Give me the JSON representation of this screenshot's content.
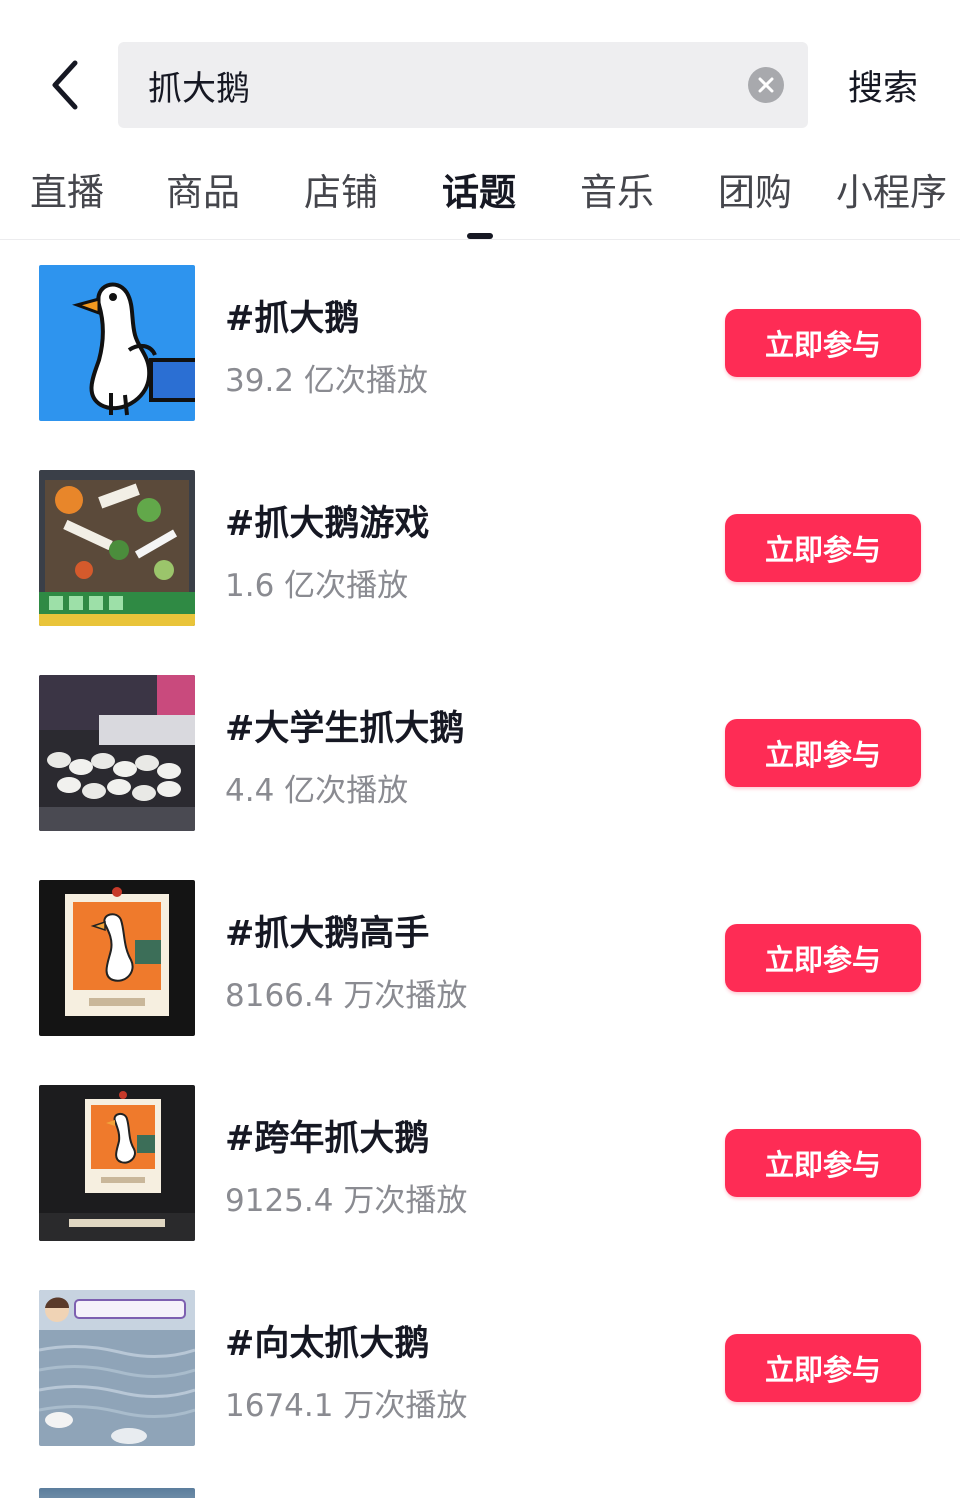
{
  "search": {
    "query": "抓大鹅",
    "button_label": "搜索"
  },
  "tabs": [
    {
      "label": "直播",
      "active": false
    },
    {
      "label": "商品",
      "active": false
    },
    {
      "label": "店铺",
      "active": false
    },
    {
      "label": "话题",
      "active": true
    },
    {
      "label": "音乐",
      "active": false
    },
    {
      "label": "团购",
      "active": false
    },
    {
      "label": "小程序",
      "active": false
    }
  ],
  "topics": [
    {
      "title": "#抓大鹅",
      "views": "39.2 亿次播放",
      "button": "立即参与",
      "thumb_icon": "goose-cartoon-icon"
    },
    {
      "title": "#抓大鹅游戏",
      "views": "1.6 亿次播放",
      "button": "立即参与",
      "thumb_icon": "game-screenshot-icon"
    },
    {
      "title": "#大学生抓大鹅",
      "views": "4.4 亿次播放",
      "button": "立即参与",
      "thumb_icon": "geese-crowd-photo-icon"
    },
    {
      "title": "#抓大鹅高手",
      "views": "8166.4 万次播放",
      "button": "立即参与",
      "thumb_icon": "goose-poster-icon"
    },
    {
      "title": "#跨年抓大鹅",
      "views": "9125.4 万次播放",
      "button": "立即参与",
      "thumb_icon": "goose-poster-icon"
    },
    {
      "title": "#向太抓大鹅",
      "views": "1674.1 万次播放",
      "button": "立即参与",
      "thumb_icon": "goose-water-photo-icon"
    }
  ],
  "colors": {
    "accent": "#fe2c55",
    "text_primary": "#161823",
    "text_secondary": "#8a8b91",
    "search_bg": "#eeeef0"
  }
}
